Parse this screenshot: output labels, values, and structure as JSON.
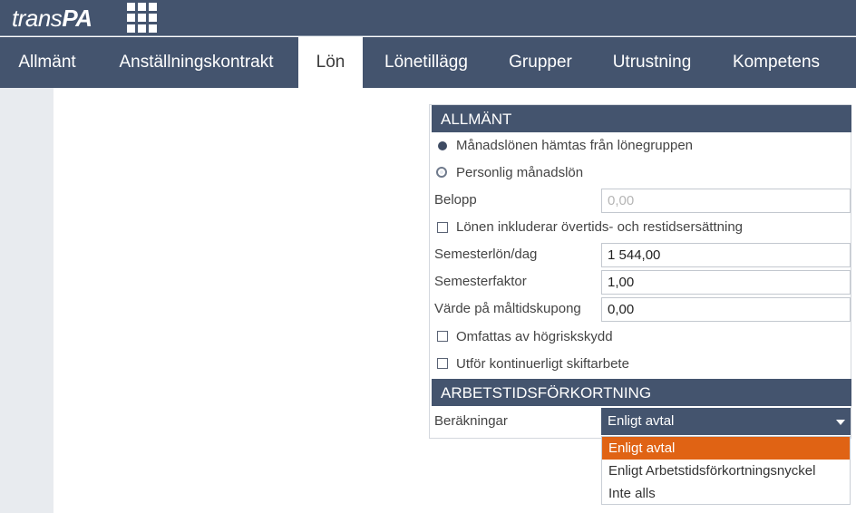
{
  "app": {
    "logo_light": "trans",
    "logo_bold": "PA",
    "apps_icon": "grid-icon"
  },
  "tabs": [
    "Allmänt",
    "Anställningskontrakt",
    "Lön",
    "Lönetillägg",
    "Grupper",
    "Utrustning",
    "Kompetens"
  ],
  "active_tab": "Lön",
  "allmant": {
    "title": "ALLMÄNT",
    "radio_group": "Månadslönen hämtas från lönegruppen",
    "radio_personal": "Personlig månadslön",
    "belopp_label": "Belopp",
    "belopp_value": "0,00",
    "overtime_label": "Lönen inkluderar övertids- och restidsersättning",
    "semesterlon_label": "Semesterlön/dag",
    "semesterlon_value": "1 544,00",
    "semesterfaktor_label": "Semesterfaktor",
    "semesterfaktor_value": "1,00",
    "maltid_label": "Värde på måltidskupong",
    "maltid_value": "0,00",
    "hogrisk_label": "Omfattas av högriskskydd",
    "skift_label": "Utför kontinuerligt skiftarbete"
  },
  "arbetstid": {
    "title": "ARBETSTIDSFÖRKORTNING",
    "berakningar_label": "Beräkningar",
    "selected": "Enligt avtal",
    "options": [
      "Enligt avtal",
      "Enligt Arbetstidsförkortningsnyckel",
      "Inte alls"
    ]
  },
  "colors": {
    "header": "#44546e",
    "highlight": "#e06314",
    "sidebar": "#e8ebef"
  }
}
